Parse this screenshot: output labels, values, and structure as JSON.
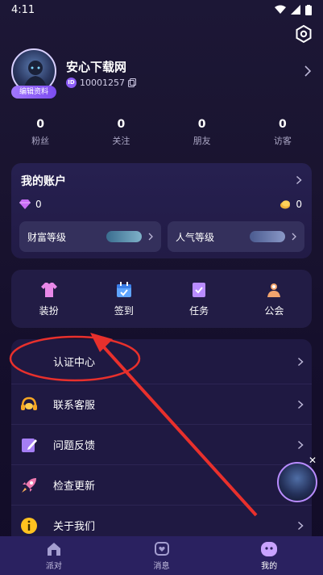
{
  "status_bar": {
    "time": "4:11"
  },
  "profile": {
    "username": "安心下载网",
    "uid": "10001257",
    "edit_label": "编辑资料",
    "id_badge": "ID"
  },
  "stats": [
    {
      "value": "0",
      "label": "粉丝"
    },
    {
      "value": "0",
      "label": "关注"
    },
    {
      "value": "0",
      "label": "朋友"
    },
    {
      "value": "0",
      "label": "访客"
    }
  ],
  "account": {
    "title": "我的账户",
    "diamonds": "0",
    "coins": "0",
    "wealth_level_label": "财富等级",
    "popularity_level_label": "人气等级"
  },
  "tasks": [
    {
      "label": "装扮",
      "icon": "shirt-icon"
    },
    {
      "label": "签到",
      "icon": "calendar-check-icon"
    },
    {
      "label": "任务",
      "icon": "task-doc-icon"
    },
    {
      "label": "公会",
      "icon": "guild-people-icon"
    }
  ],
  "menu": [
    {
      "label": "认证中心",
      "icon": "none"
    },
    {
      "label": "联系客服",
      "icon": "headset-icon"
    },
    {
      "label": "问题反馈",
      "icon": "feedback-edit-icon"
    },
    {
      "label": "检查更新",
      "icon": "rocket-icon"
    },
    {
      "label": "关于我们",
      "icon": "info-icon"
    }
  ],
  "bottom_nav": [
    {
      "label": "派对",
      "icon": "party-house-icon",
      "active": false
    },
    {
      "label": "消息",
      "icon": "message-heart-icon",
      "active": false
    },
    {
      "label": "我的",
      "icon": "me-face-icon",
      "active": true
    }
  ],
  "colors": {
    "accent": "#8c5cf6",
    "annotation_red": "#e8302c",
    "card_bg": "#221c45"
  }
}
